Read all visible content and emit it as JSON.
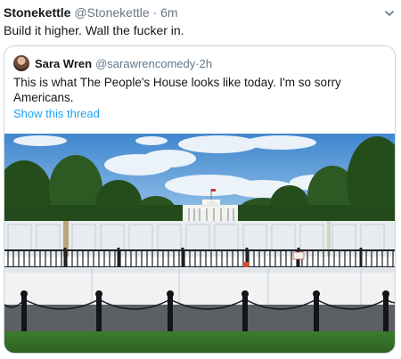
{
  "tweet": {
    "display_name": "Stonekettle",
    "handle": "@Stonekettle",
    "separator": "·",
    "time": "6m",
    "text": "Build it higher. Wall the fucker in.",
    "menu_icon": "chevron-down-icon"
  },
  "quoted_tweet": {
    "display_name": "Sara Wren",
    "handle": "@sarawrencomedy",
    "separator": "·",
    "time": "2h",
    "text": "This is what The People's House looks like today. I'm so sorry Americans.",
    "show_thread_label": "Show this thread",
    "link_color": "#1da1f2"
  },
  "photo": {
    "subject": "white-house-behind-fence-photo"
  }
}
